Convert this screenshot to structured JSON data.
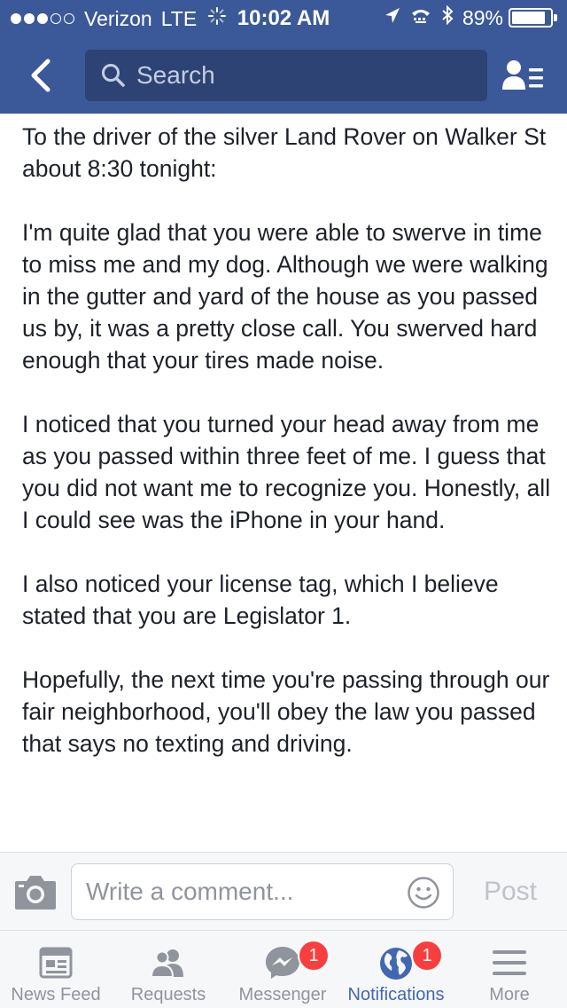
{
  "status_bar": {
    "carrier": "Verizon",
    "network": "LTE",
    "time": "10:02 AM",
    "battery": "89%",
    "battery_level": 0.89,
    "signal_bars_filled": 3,
    "signal_bars_total": 5
  },
  "header": {
    "search_placeholder": "Search",
    "back_icon": "chevron-left-icon",
    "profile_icon": "friend-list-icon"
  },
  "post": {
    "text": "To the driver of the silver Land Rover on Walker St about 8:30 tonight:\n\nI'm quite glad that you were able to swerve in time to miss me and my dog. Although we were walking in the gutter and yard of the house as you passed us by, it was a pretty close call. You swerved hard enough that your tires made noise.\n\nI noticed that you turned your head away from me as you passed within three feet of me. I guess that you did not want me to recognize you. Honestly, all I could see was the iPhone in your hand.\n\nI also noticed your license tag, which I believe stated that you are Legislator 1.\n\nHopefully, the next time you're passing through our fair neighborhood, you'll obey the law you passed that says no texting and driving."
  },
  "comment": {
    "placeholder": "Write a comment...",
    "post_label": "Post"
  },
  "tabs": [
    {
      "label": "News Feed",
      "icon": "news-feed-icon",
      "badge": null,
      "active": false
    },
    {
      "label": "Requests",
      "icon": "friend-requests-icon",
      "badge": null,
      "active": false
    },
    {
      "label": "Messenger",
      "icon": "messenger-icon",
      "badge": "1",
      "active": false
    },
    {
      "label": "Notifications",
      "icon": "globe-icon",
      "badge": "1",
      "active": true
    },
    {
      "label": "More",
      "icon": "menu-icon",
      "badge": null,
      "active": false
    }
  ],
  "colors": {
    "brand": "#3b5998",
    "search_bg": "#2d4373",
    "active_tab": "#4267b2",
    "badge": "#fa3e3e",
    "text": "#1d2129",
    "muted": "#90949c"
  }
}
